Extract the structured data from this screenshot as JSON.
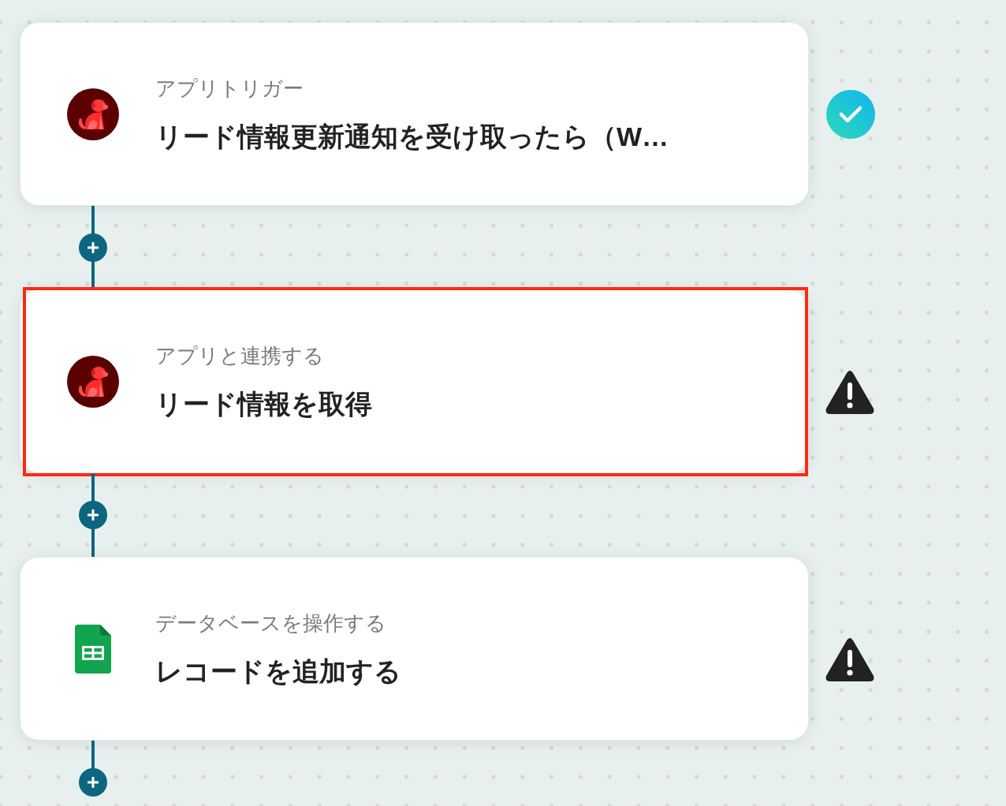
{
  "steps": [
    {
      "kind": "dog",
      "label": "アプリトリガー",
      "title": "リード情報更新通知を受け取ったら（W…",
      "complete": true,
      "highlighted": false
    },
    {
      "kind": "dog",
      "label": "アプリと連携する",
      "title": "リード情報を取得",
      "complete": false,
      "highlighted": true
    },
    {
      "kind": "sheet",
      "label": "データベースを操作する",
      "title": "レコードを追加する",
      "complete": false,
      "highlighted": false
    }
  ]
}
